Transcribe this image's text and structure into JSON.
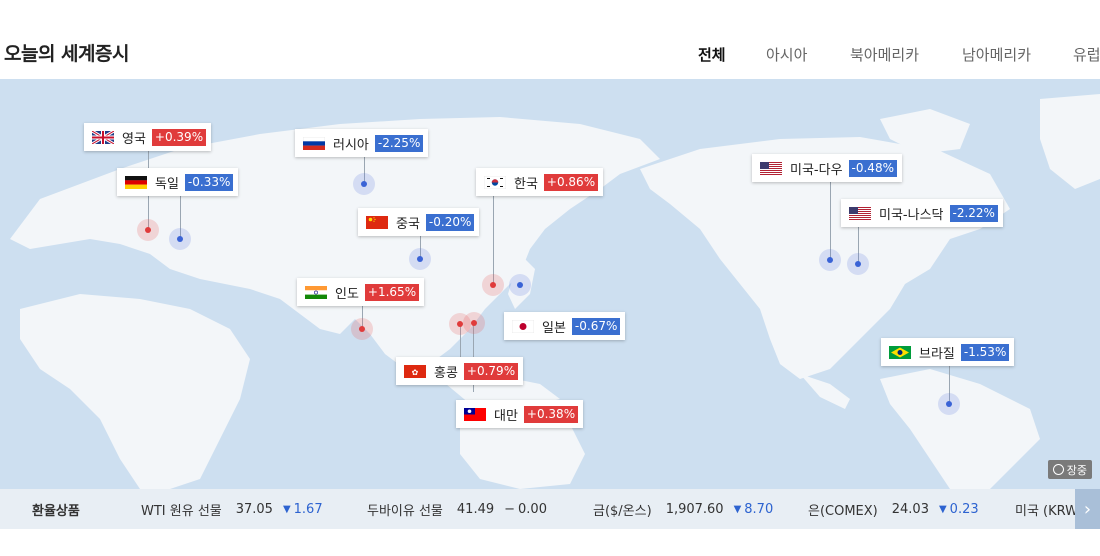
{
  "page_title": "오늘의 세계증시",
  "tabs": [
    "전체",
    "아시아",
    "북아메리카",
    "남아메리카",
    "유럽"
  ],
  "active_tab": "전체",
  "markets": [
    {
      "id": "uk",
      "name": "영국",
      "change": "+0.39%",
      "dir": "up",
      "flag": "uk-flag"
    },
    {
      "id": "de",
      "name": "독일",
      "change": "-0.33%",
      "dir": "down",
      "flag": "germany-flag"
    },
    {
      "id": "ru",
      "name": "러시아",
      "change": "-2.25%",
      "dir": "down",
      "flag": "russia-flag"
    },
    {
      "id": "kr",
      "name": "한국",
      "change": "+0.86%",
      "dir": "up",
      "flag": "korea-flag"
    },
    {
      "id": "cn",
      "name": "중국",
      "change": "-0.20%",
      "dir": "down",
      "flag": "china-flag"
    },
    {
      "id": "in",
      "name": "인도",
      "change": "+1.65%",
      "dir": "up",
      "flag": "india-flag"
    },
    {
      "id": "jp",
      "name": "일본",
      "change": "-0.67%",
      "dir": "down",
      "flag": "japan-flag"
    },
    {
      "id": "hk",
      "name": "홍콩",
      "change": "+0.79%",
      "dir": "up",
      "flag": "hongkong-flag"
    },
    {
      "id": "tw",
      "name": "대만",
      "change": "+0.38%",
      "dir": "up",
      "flag": "taiwan-flag"
    },
    {
      "id": "dow",
      "name": "미국-다우",
      "change": "-0.48%",
      "dir": "down",
      "flag": "usa-flag"
    },
    {
      "id": "nasdaq",
      "name": "미국-나스닥",
      "change": "-2.22%",
      "dir": "down",
      "flag": "usa-flag"
    },
    {
      "id": "br",
      "name": "브라질",
      "change": "-1.53%",
      "dir": "down",
      "flag": "brazil-flag"
    }
  ],
  "map_badge": "장중",
  "ticker": {
    "heading": "환율상품",
    "items": [
      {
        "label": "WTI 원유 선물",
        "value": "37.05",
        "arrow": "▼",
        "change": "1.67",
        "dir": "down"
      },
      {
        "label": "두바이유 선물",
        "value": "41.49",
        "arrow": "−",
        "change": "0.00",
        "dir": "flat"
      },
      {
        "label": "금($/온스)",
        "value": "1,907.60",
        "arrow": "▼",
        "change": "8.70",
        "dir": "down"
      },
      {
        "label": "은(COMEX)",
        "value": "24.03",
        "arrow": "▼",
        "change": "0.23",
        "dir": "down"
      },
      {
        "label": "미국 (KRW",
        "value": "",
        "arrow": "",
        "change": "",
        "dir": "flat"
      }
    ],
    "next_icon": "chevron-right-icon"
  }
}
